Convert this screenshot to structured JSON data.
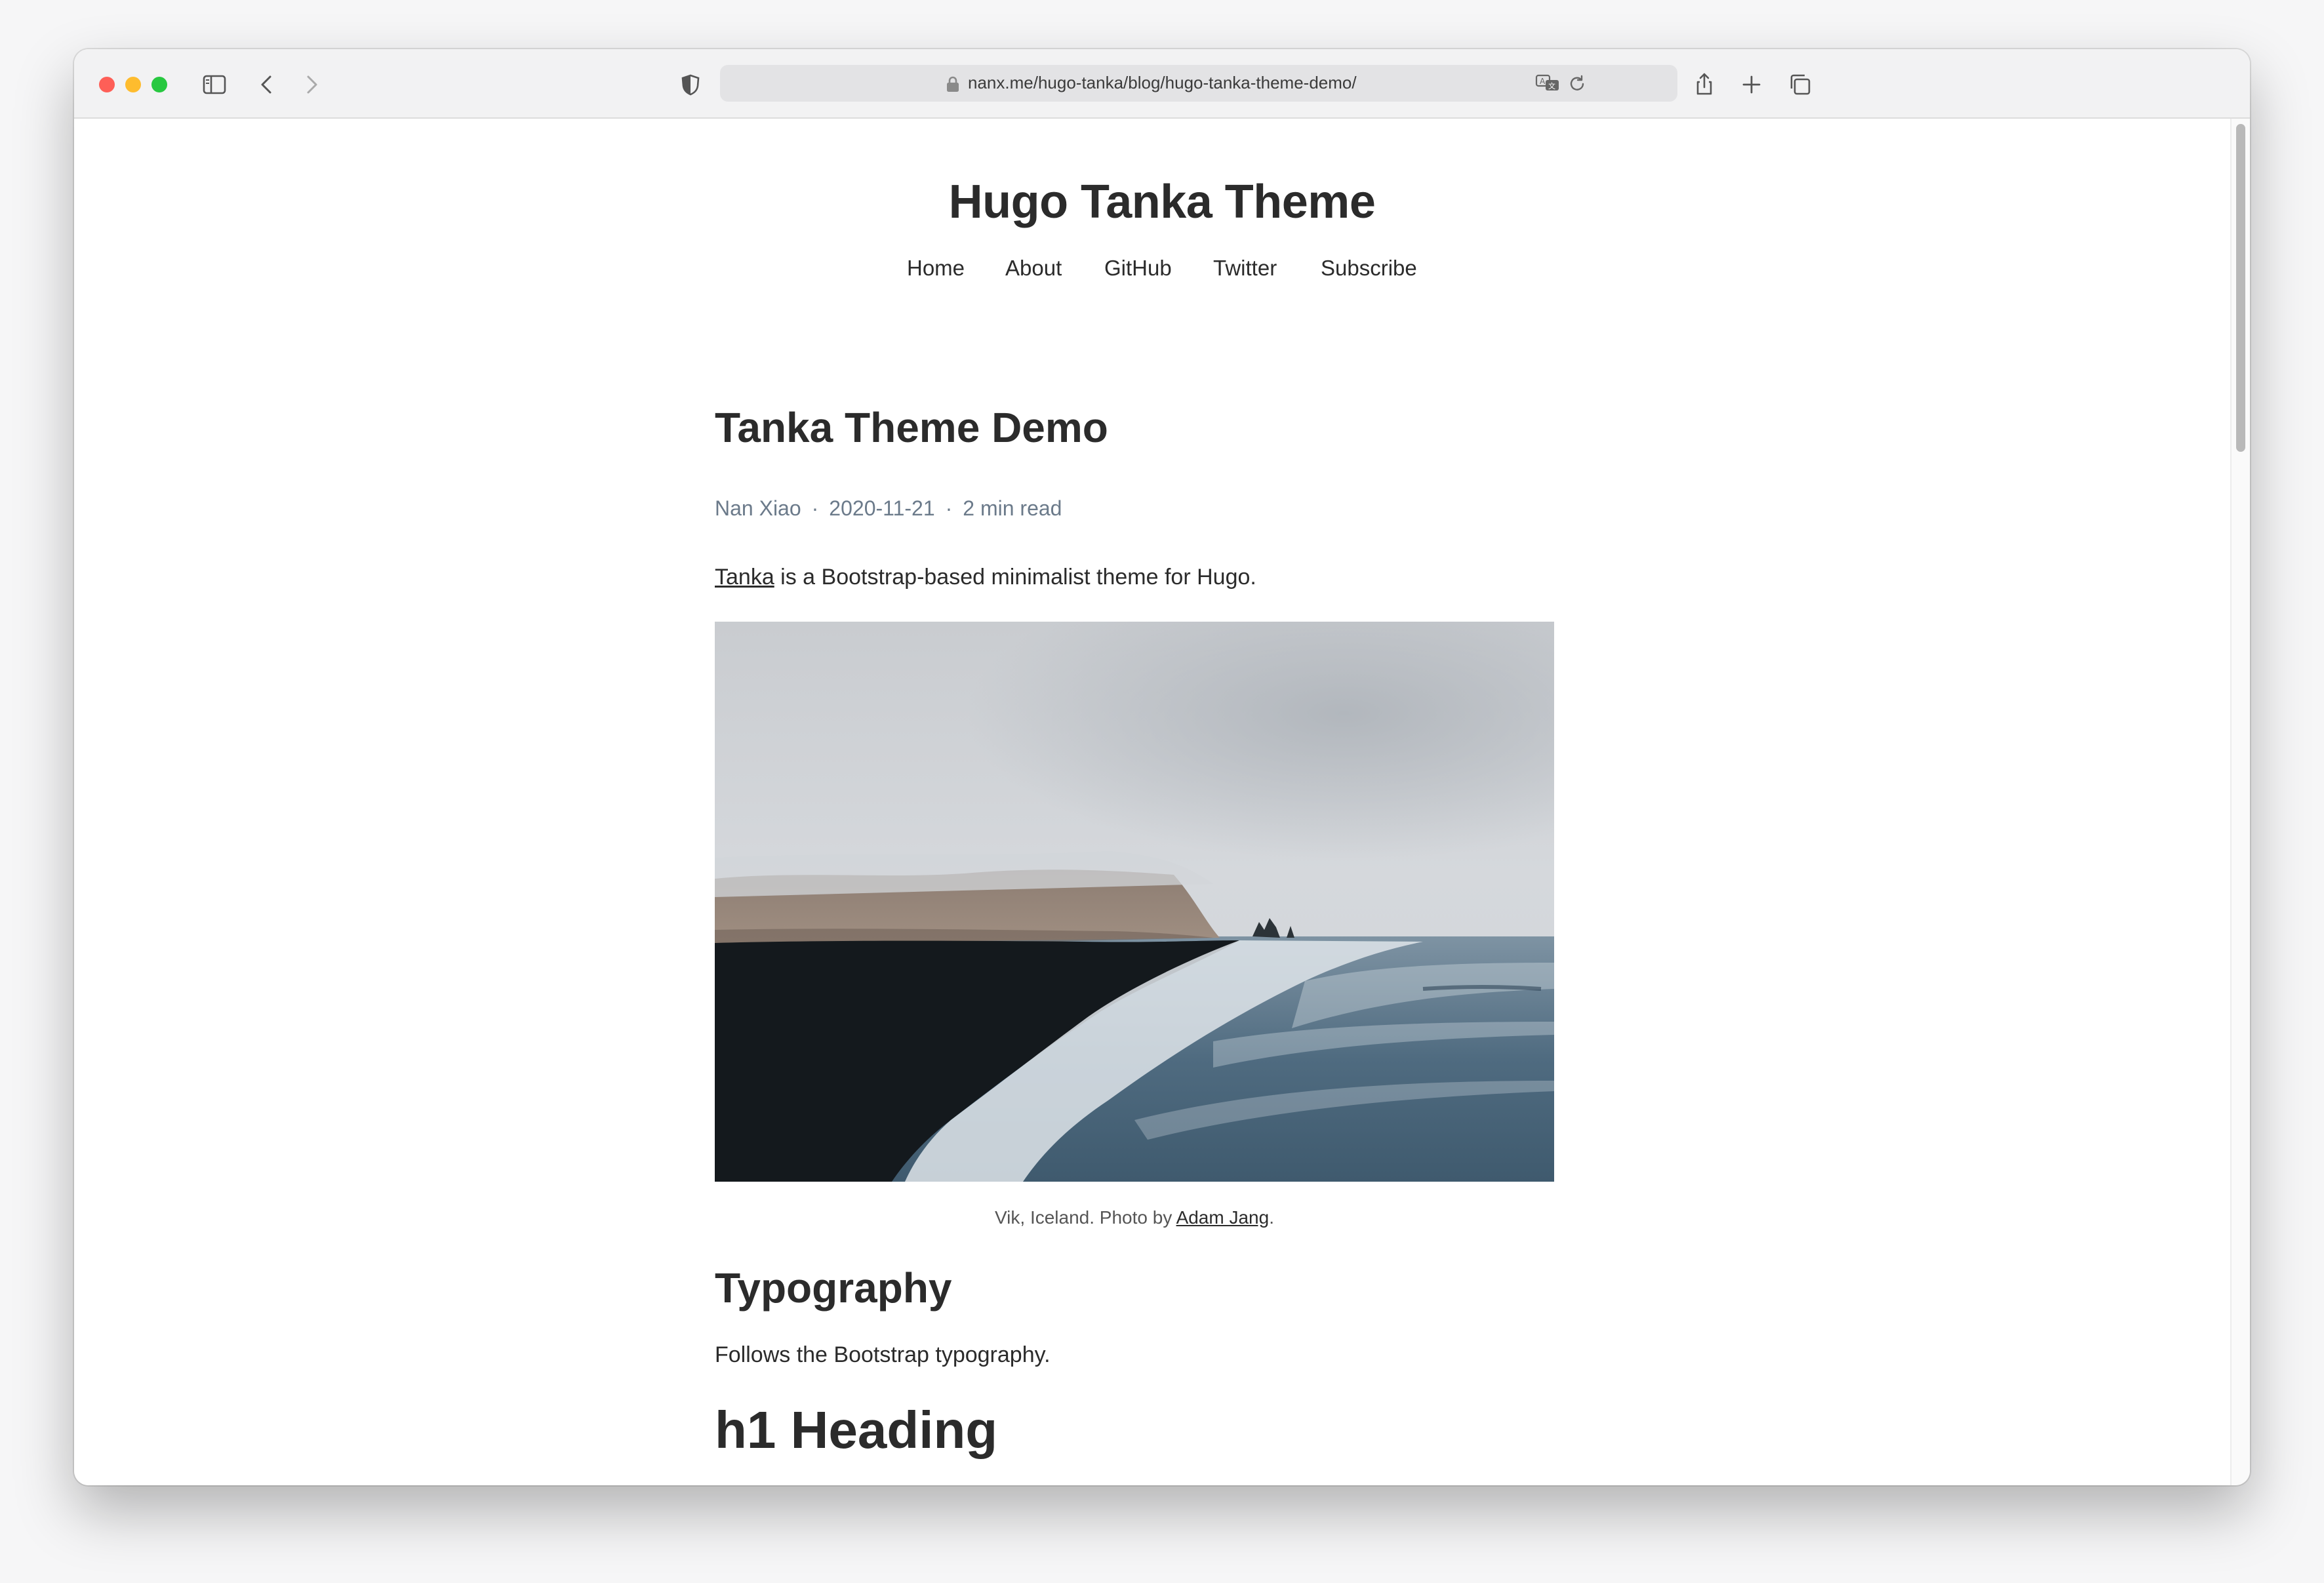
{
  "browser": {
    "url": "nanx.me/hugo-tanka/blog/hugo-tanka-theme-demo/"
  },
  "site": {
    "title": "Hugo Tanka Theme",
    "nav": [
      "Home",
      "About",
      "GitHub",
      "Twitter",
      "Subscribe"
    ]
  },
  "post": {
    "title": "Tanka Theme Demo",
    "author": "Nan Xiao",
    "separator": "·",
    "date": "2020-11-21",
    "read_time": "2 min read",
    "intro_link": "Tanka",
    "intro_rest": " is a Bootstrap-based minimalist theme for Hugo.",
    "caption_prefix": "Vik, Iceland. Photo by ",
    "caption_link": "Adam Jang",
    "caption_suffix": ".",
    "section_heading": "Typography",
    "section_text": "Follows the Bootstrap typography.",
    "h1_demo": "h1 Heading"
  },
  "icons": {
    "sidebar": "sidebar-icon",
    "back": "chevron-left-icon",
    "forward": "chevron-right-icon",
    "privacy": "shield-icon",
    "lock": "lock-icon",
    "translate": "translate-icon",
    "reload": "reload-icon",
    "share": "share-icon",
    "new_tab": "plus-icon",
    "tabs": "tabs-overview-icon"
  },
  "colors": {
    "traffic_red": "#fe5f57",
    "traffic_yellow": "#febc2e",
    "traffic_green": "#28c840",
    "meta_text": "#6b7a8a",
    "body_text": "#2b2b2b"
  }
}
